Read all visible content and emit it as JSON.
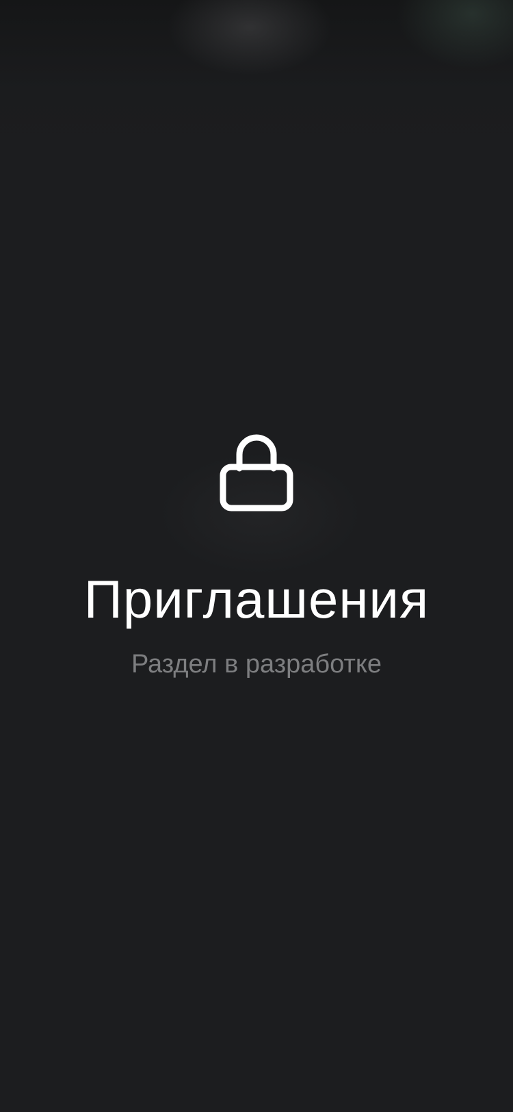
{
  "screen": {
    "icon": "lock-icon",
    "title": "Приглашения",
    "subtitle": "Раздел в разработке"
  },
  "colors": {
    "background": "#1c1d1f",
    "title": "#ffffff",
    "subtitle": "#7d7e80",
    "icon": "#ffffff"
  }
}
